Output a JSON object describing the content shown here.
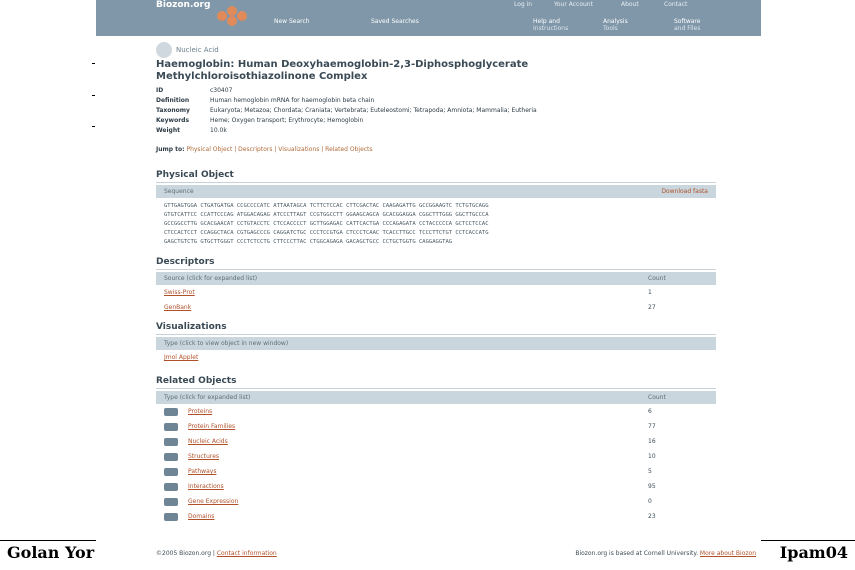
{
  "site": {
    "logo": "Biozon.org"
  },
  "top_links": [
    "Log in",
    "Your Account",
    "About",
    "Contact"
  ],
  "toolbar": {
    "new_search": "New Search",
    "saved_searches": "Saved Searches",
    "help1": "Help and",
    "help2": "Instructions",
    "analysis1": "Analysis",
    "analysis2": "Tools",
    "software1": "Software",
    "software2": "and Files"
  },
  "page": {
    "type_label": "Nucleic Acid",
    "title_line1": "Haemoglobin: Human Deoxyhaemoglobin-2,3-Diphosphoglycerate",
    "title_line2": "Methylchloroisothiazolinone Complex"
  },
  "meta": [
    {
      "k": "ID",
      "v": "c30407"
    },
    {
      "k": "Definition",
      "v": "Human hemoglobin mRNA for haemoglobin beta chain"
    },
    {
      "k": "Taxonomy",
      "v": "Eukaryota; Metazoa; Chordata; Craniata; Vertebrata; Euteleostomi; Tetrapoda; Amniota; Mammalia; Eutheria"
    },
    {
      "k": "Keywords",
      "v": "Heme; Oxygen transport; Erythrocyte; Hemoglobin"
    },
    {
      "k": "Weight",
      "v": "10.0k"
    }
  ],
  "navline": {
    "label": "Jump to:",
    "items": [
      "Physical Object",
      "Descriptors",
      "Visualizations",
      "Related Objects"
    ]
  },
  "physical": {
    "title": "Physical Object",
    "header_left": "Sequence",
    "header_right": "Download fasta",
    "lines": [
      "GTTGAGTGGA CTGATGATGA CCGCCCCATC ATTAATAGCA TCTTCTCCAC CTTCGACTAC CAAGAGATTG GCCGGAAGTC TCTGTGCAGG",
      "GTGTCATTCC CCATTCCCAG ATGGACAGAG ATCCCTTAGT CCGTGGCCTT GGAAGCAGCA GCACGGAGGA CGGCTTTGGG GGCTTGCCCA",
      "GCCGGCCTTG GCACGAACAT CCTGTACCTC CTCCACCCCT GCTTGGAGAC CATTCACTGA CCCAGAGATA CCTACCCCCA GCTCCTCCAC",
      "CTCCACTCCT CCAGGCTACA CGTGAGCCCG CAGGATCTGC CCCTCCGTGA CTCCCTCAAC TCACCTTGCC TCCCTTCTGT CCTCACCATG",
      "GAGCTGTCTG GTGCTTGGGT CCCTCTCCTG CTTCCCTTAC CTGGCAGAGA GACAGCTGCC CCTGCTGGTG CAGGAGGTAG"
    ]
  },
  "descriptors": {
    "title": "Descriptors",
    "header_left": "Source (click for expanded list)",
    "header_right": "Count",
    "rows": [
      {
        "name": "Swiss-Prot",
        "count": "1"
      },
      {
        "name": "GenBank",
        "count": "27"
      }
    ]
  },
  "visualizations": {
    "title": "Visualizations",
    "header_left": "Type (click to view object in new window)",
    "rows": [
      {
        "name": "Jmol Applet"
      }
    ]
  },
  "related": {
    "title": "Related Objects",
    "header_left": "Type (click for expanded list)",
    "header_right": "Count",
    "rows": [
      {
        "name": "Proteins",
        "count": "6",
        "icon": "protein-icon"
      },
      {
        "name": "Protein Families",
        "count": "77",
        "icon": "protein-family-icon"
      },
      {
        "name": "Nucleic Acids",
        "count": "16",
        "icon": "nucleic-acid-icon"
      },
      {
        "name": "Structures",
        "count": "10",
        "icon": "structure-icon"
      },
      {
        "name": "Pathways",
        "count": "5",
        "icon": "pathway-icon"
      },
      {
        "name": "Interactions",
        "count": "95",
        "icon": "interaction-icon"
      },
      {
        "name": "Gene Expression",
        "count": "0",
        "icon": "gene-expression-icon"
      },
      {
        "name": "Domains",
        "count": "23",
        "icon": "domain-icon"
      }
    ]
  },
  "footer": {
    "left": "©2005 Biozon.org",
    "left_link": "Contact information",
    "right": "Biozon.org is based at Cornell University.",
    "right_link": "More about Biozon"
  },
  "slide": {
    "author": "Golan Yor",
    "tag": "Ipam04"
  }
}
